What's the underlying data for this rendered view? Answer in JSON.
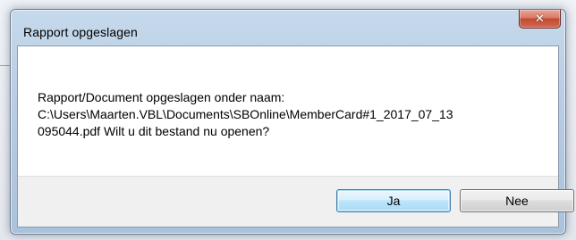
{
  "dialog": {
    "title": "Rapport opgeslagen",
    "close_icon": "close-icon",
    "close_glyph": "✕",
    "message_lines": [
      "Rapport/Document opgeslagen onder naam:",
      "C:\\Users\\Maarten.VBL\\Documents\\SBOnline\\MemberCard#1_2017_07_13",
      "095044.pdf Wilt u dit bestand nu openen?"
    ],
    "buttons": {
      "yes_label": "Ja",
      "no_label": "Nee"
    }
  },
  "colors": {
    "frame": "#b8cde3",
    "close_button": "#c24a30",
    "button_bar": "#f0f0f0",
    "default_button_border": "#3c7fb1"
  }
}
